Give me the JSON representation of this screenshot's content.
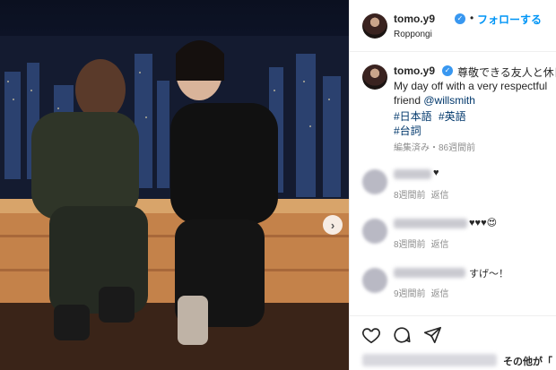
{
  "post": {
    "username": "tomo.y9",
    "follow_label": "フォローする",
    "location": "Roppongi",
    "separator": "•"
  },
  "caption": {
    "username": "tomo.y9",
    "line1": "尊敬できる友人と休日",
    "line2": "My day off with a very respectful",
    "line3_prefix": "friend ",
    "mention": "@willsmith",
    "tags": [
      "#日本語",
      "#英語",
      "#台詞"
    ],
    "meta": "編集済み・86週間前"
  },
  "comments": [
    {
      "text": "♥",
      "time": "8週間前",
      "reply": "返信"
    },
    {
      "text": "♥♥♥😍",
      "time": "8週間前",
      "reply": "返信"
    },
    {
      "text": "すげ〜！",
      "time": "9週間前",
      "reply": "返信"
    }
  ],
  "likes": {
    "others": "その他が「"
  },
  "icons": {
    "verified": "verified-badge-icon",
    "next": "chevron-right-icon",
    "heart": "heart-icon",
    "comment": "comment-icon",
    "share": "paper-plane-icon"
  },
  "colors": {
    "accent": "#0095f6",
    "verified": "#3897f0",
    "link": "#00376b",
    "muted": "#8e8e8e"
  }
}
